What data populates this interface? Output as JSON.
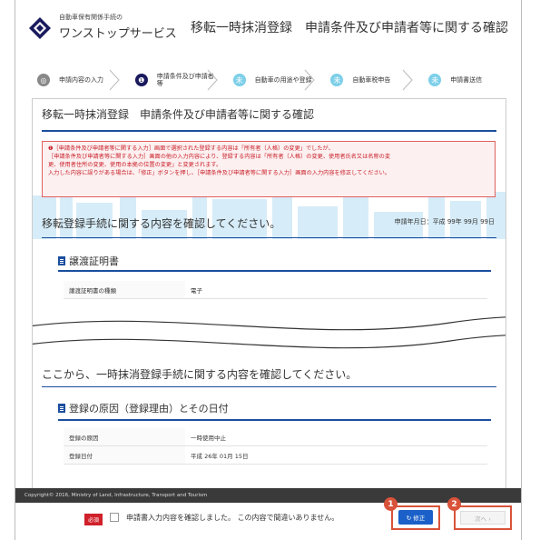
{
  "header": {
    "logo_sub": "自動車保有関係手続の",
    "logo_main": "ワンストップサービス",
    "page_title": "移転一時抹消登録　申請条件及び申請者等に関する確認"
  },
  "steps": [
    {
      "num": "◎",
      "label": "申請内容の入力",
      "state": "done"
    },
    {
      "num": "❶",
      "label": "申請条件及び申請者等",
      "state": "current"
    },
    {
      "num": "未",
      "label": "自動車の用途や登録",
      "state": "todo"
    },
    {
      "num": "未",
      "label": "自動車税申告",
      "state": "todo"
    },
    {
      "num": "未",
      "label": "申請書送信",
      "state": "todo"
    }
  ],
  "card": {
    "title": "移転一時抹消登録　申請条件及び申請者等に関する確認",
    "alert_lines": [
      "❶［申請条件及び申請者等に関する入力］画面で選択された登録する内容は「所有者（人格）の変更」でしたが、",
      "［申請条件及び申請者等に関する入力］画面の他の入力内容により、登録する内容は「所有者（人格）の変更、使用者氏名又は名称の変",
      "更、使用者住所の変更、使用の本拠の位置の変更」と変更されます。",
      "入力した内容に誤りがある場合は、「修正」ボタンを押し、［申請条件及び申請者等に関する入力］画面の入力内容を修正してください。"
    ],
    "date_label": "申請年月日：平成 99年 99月 99日",
    "section1_heading": "移転登録手続に関する内容を確認してください。",
    "subsection1_title": "譲渡証明書",
    "subsection1_rows": [
      {
        "key": "譲渡証明書の種類",
        "value": "電子"
      }
    ],
    "section2_heading": "ここから、一時抹消登録手続に関する内容を確認してください。",
    "subsection2_title": "登録の原因（登録理由）とその日付",
    "subsection2_rows": [
      {
        "key": "登録の原因",
        "value": "一時使用中止"
      },
      {
        "key": "登録日付",
        "value": "平成 26年 01月 15日"
      }
    ]
  },
  "footer": {
    "copyright": "Copyright© 2016, Ministry of Land, Infrastructure, Transport and Tourism"
  },
  "bottom_bar": {
    "required_badge": "必須",
    "confirm_text": "申請書入力内容を確認しました。 この内容で間違いありません。",
    "fix_label": "↻ 修正",
    "next_label": "次へ ›",
    "marker1": "1",
    "marker2": "2"
  },
  "colors": {
    "accent_blue": "#1a4e9e",
    "alert_red": "#c8202a",
    "marker_orange": "#d9533a"
  }
}
